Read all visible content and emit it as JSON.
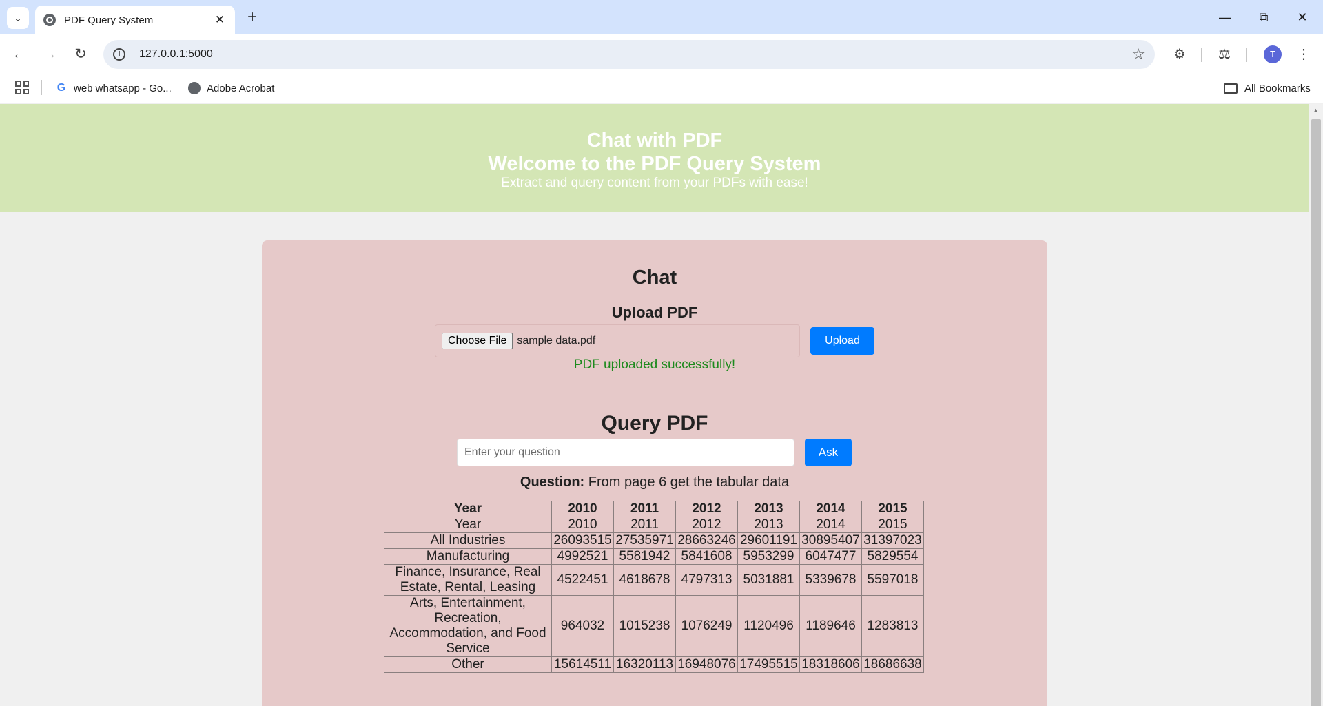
{
  "browser": {
    "tab_title": "PDF Query System",
    "url": "127.0.0.1:5000",
    "bookmarks": [
      {
        "label": "web whatsapp - Go...",
        "icon": "google-icon"
      },
      {
        "label": "Adobe Acrobat",
        "icon": "globe-icon"
      }
    ],
    "all_bookmarks": "All Bookmarks",
    "avatar_letter": "T"
  },
  "hero": {
    "title": "Chat with PDF",
    "subtitle": "Welcome to the PDF Query System",
    "tagline": "Extract and query content from your PDFs with ease!"
  },
  "chat": {
    "title": "Chat",
    "upload_title": "Upload PDF",
    "choose_file_label": "Choose File",
    "file_name": "sample data.pdf",
    "upload_label": "Upload",
    "success_message": "PDF uploaded successfully!"
  },
  "query": {
    "title": "Query PDF",
    "placeholder": "Enter your question",
    "ask_label": "Ask",
    "question_label": "Question:",
    "question_text": "From page 6 get the tabular data"
  },
  "table": {
    "headers": [
      "Year",
      "2010",
      "2011",
      "2012",
      "2013",
      "2014",
      "2015"
    ],
    "rows": [
      [
        "Year",
        "2010",
        "2011",
        "2012",
        "2013",
        "2014",
        "2015"
      ],
      [
        "All Industries",
        "26093515",
        "27535971",
        "28663246",
        "29601191",
        "30895407",
        "31397023"
      ],
      [
        "Manufacturing",
        "4992521",
        "5581942",
        "5841608",
        "5953299",
        "6047477",
        "5829554"
      ],
      [
        "Finance, Insurance, Real Estate, Rental, Leasing",
        "4522451",
        "4618678",
        "4797313",
        "5031881",
        "5339678",
        "5597018"
      ],
      [
        "Arts, Entertainment, Recreation, Accommodation, and Food Service",
        "964032",
        "1015238",
        "1076249",
        "1120496",
        "1189646",
        "1283813"
      ],
      [
        "Other",
        "15614511",
        "16320113",
        "16948076",
        "17495515",
        "18318606",
        "18686638"
      ]
    ]
  },
  "colors": {
    "hero_bg": "#d4e6b5",
    "card_bg": "#e6c9c9",
    "primary_button": "#007bff",
    "success_text": "#1d8a1d"
  }
}
